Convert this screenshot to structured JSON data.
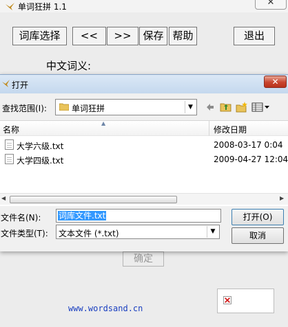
{
  "main_window": {
    "title": "单词狂拼 1.1",
    "close_glyph": "✕",
    "toolbar": {
      "lib_select": "词库选择",
      "prev": "<<",
      "next": ">>",
      "save": "保存",
      "help": "帮助",
      "exit": "退出"
    },
    "chinese_meaning_label": "中文词义:",
    "confirm_button": "确定",
    "website": "www.wordsand.cn"
  },
  "open_dialog": {
    "title": "打开",
    "close_glyph": "✕",
    "look_in_label": "查找范围(I):",
    "look_in_value": "单词狂拼",
    "toolbar_icons": [
      "back-icon",
      "up-folder-icon",
      "new-folder-icon",
      "view-menu-icon"
    ],
    "columns": {
      "name": "名称",
      "modified": "修改日期"
    },
    "files": [
      {
        "name": "大学六级.txt",
        "modified": "2008-03-17 0:04"
      },
      {
        "name": "大学四级.txt",
        "modified": "2009-04-27 12:04"
      }
    ],
    "file_name_label": "文件名(N):",
    "file_name_value": "词库文件.txt",
    "file_type_label": "文件类型(T):",
    "file_type_value": "文本文件 (*.txt)",
    "open_button": "打开(O)",
    "cancel_button": "取消"
  }
}
